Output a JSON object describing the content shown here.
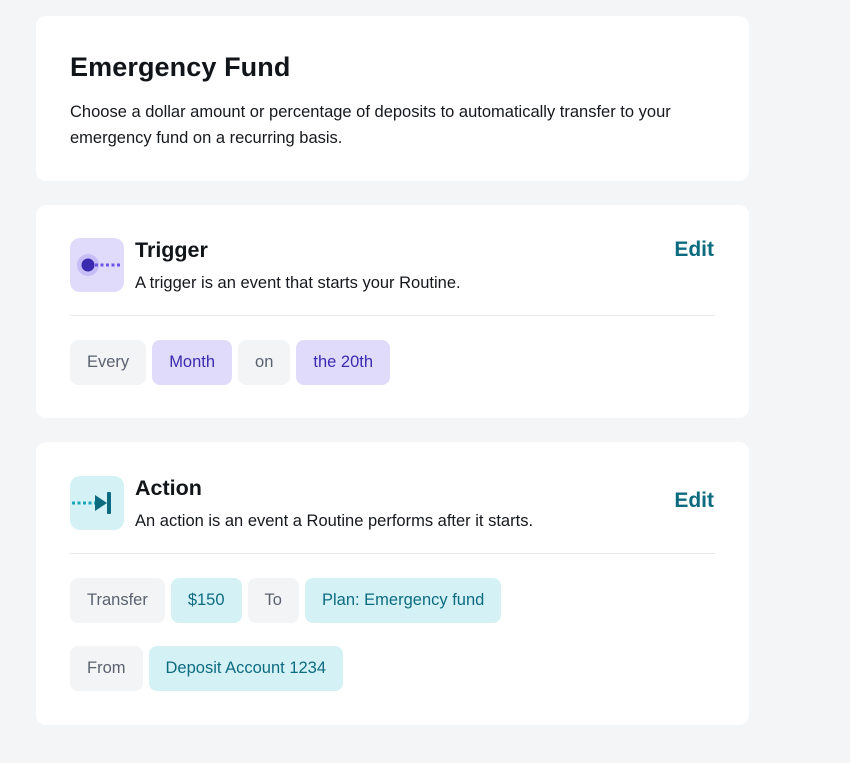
{
  "intro": {
    "title": "Emergency Fund",
    "description": "Choose a dollar amount or percentage of deposits to automatically transfer to your emergency fund on a recurring basis."
  },
  "trigger": {
    "icon": "trigger-dot-icon",
    "title": "Trigger",
    "description": "A trigger is an event that starts your Routine.",
    "edit_label": "Edit",
    "chips": [
      {
        "text": "Every",
        "style": "neutral"
      },
      {
        "text": "Month",
        "style": "purple"
      },
      {
        "text": "on",
        "style": "neutral"
      },
      {
        "text": "the 20th",
        "style": "purple"
      }
    ]
  },
  "action": {
    "icon": "action-arrow-icon",
    "title": "Action",
    "description": "An action is an event a Routine performs after it starts.",
    "edit_label": "Edit",
    "row1": [
      {
        "text": "Transfer",
        "style": "neutral"
      },
      {
        "text": "$150",
        "style": "teal"
      },
      {
        "text": "To",
        "style": "neutral"
      },
      {
        "text": "Plan: Emergency fund",
        "style": "teal"
      }
    ],
    "row2": [
      {
        "text": "From",
        "style": "neutral"
      },
      {
        "text": "Deposit Account 1234",
        "style": "teal"
      }
    ]
  },
  "colors": {
    "page_bg": "#f4f5f7",
    "accent_teal": "#0d6b80",
    "accent_purple": "#3b2ab0",
    "purple_chip_bg": "#e0dbfb",
    "teal_chip_bg": "#d4f2f6"
  }
}
